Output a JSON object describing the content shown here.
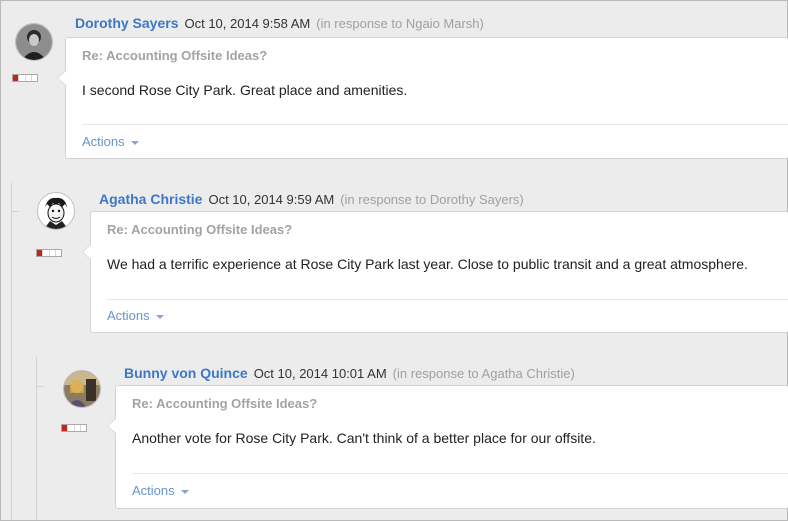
{
  "replies": [
    {
      "author": "Dorothy Sayers",
      "date": "Oct 10, 2014 9:58 AM",
      "in_response": "(in response to Ngaio Marsh)",
      "subject": "Re: Accounting Offsite Ideas?",
      "body": "I second Rose City Park. Great place and amenities.",
      "actions_label": "Actions",
      "status_level": 1
    },
    {
      "author": "Agatha Christie",
      "date": "Oct 10, 2014 9:59 AM",
      "in_response": "(in response to Dorothy Sayers)",
      "subject": "Re: Accounting Offsite Ideas?",
      "body": "We had a terrific experience at Rose City Park last year. Close to public transit and a great atmosphere.",
      "actions_label": "Actions",
      "status_level": 1
    },
    {
      "author": "Bunny von Quince",
      "date": "Oct 10, 2014 10:01 AM",
      "in_response": "(in response to Agatha Christie)",
      "subject": "Re: Accounting Offsite Ideas?",
      "body": "Another vote for Rose City Park. Can't think of a better place for our offsite.",
      "actions_label": "Actions",
      "status_level": 1
    }
  ],
  "colors": {
    "author": "#3d78c7",
    "status_on": "#c0261d",
    "actions": "#6a93c9"
  }
}
